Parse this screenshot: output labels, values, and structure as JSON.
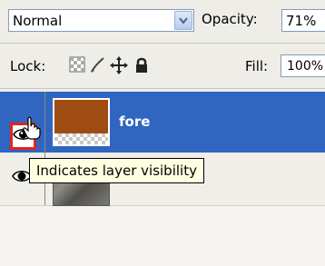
{
  "blend_mode": {
    "value": "Normal"
  },
  "opacity": {
    "label": "Opacity:",
    "value": "71%"
  },
  "lock": {
    "label": "Lock:",
    "icons": [
      "lock-transparent-pixels-icon",
      "lock-image-pixels-icon",
      "lock-position-icon",
      "lock-all-icon"
    ]
  },
  "fill": {
    "label": "Fill:",
    "value": "100%"
  },
  "layers": [
    {
      "name": "fore",
      "selected": true,
      "thumbnail_color": "#9e4c11",
      "visible": true
    },
    {
      "name": "",
      "selected": false,
      "visible": true
    }
  ],
  "tooltip": {
    "text": "Indicates layer visibility"
  },
  "colors": {
    "selection": "#3065c0",
    "highlight_box": "#e1261c",
    "tooltip_bg": "#ffffe1"
  }
}
